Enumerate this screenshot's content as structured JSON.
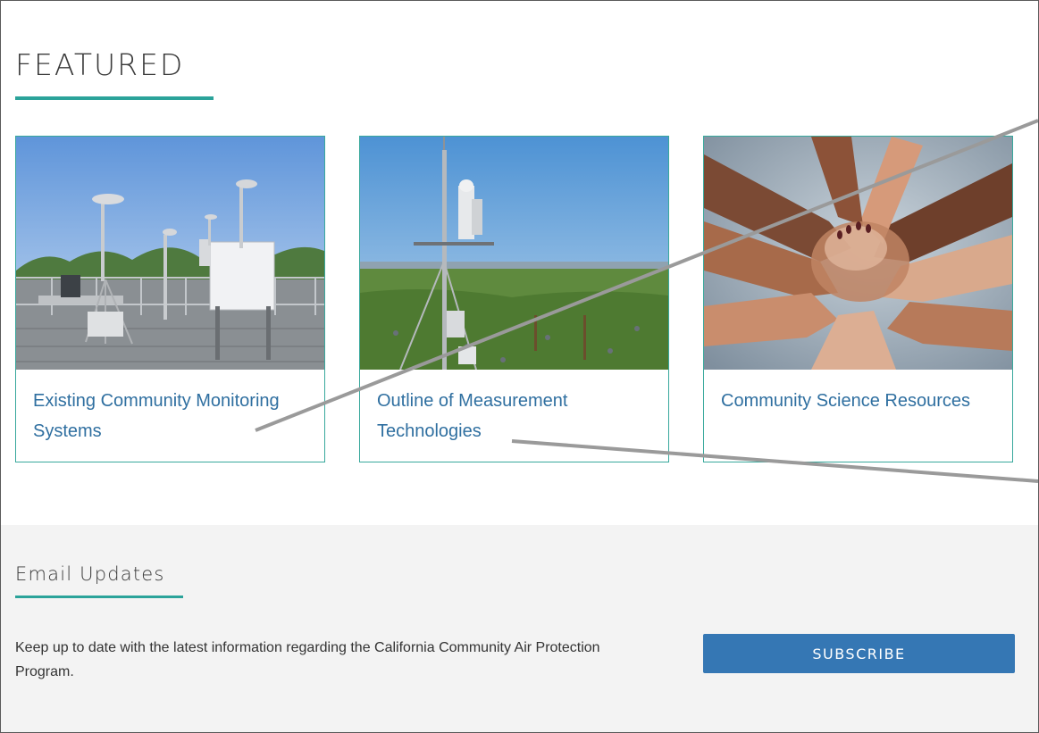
{
  "featured": {
    "title": "FEATURED",
    "cards": [
      {
        "title": "Existing Community Monitoring Systems",
        "image_icon": "air-monitoring-station-image"
      },
      {
        "title": "Outline of Measurement Technologies",
        "image_icon": "meteorological-tower-image"
      },
      {
        "title": "Community Science Resources",
        "image_icon": "stacked-hands-image"
      }
    ]
  },
  "email_updates": {
    "title": "Email Updates",
    "description": "Keep up to date with the latest information regarding the California Community Air Protection Program.",
    "subscribe_label": "SUBSCRIBE"
  },
  "colors": {
    "accent": "#2ba39a",
    "link": "#2f6fa0",
    "button": "#3577b4",
    "section_bg": "#f3f3f3"
  }
}
